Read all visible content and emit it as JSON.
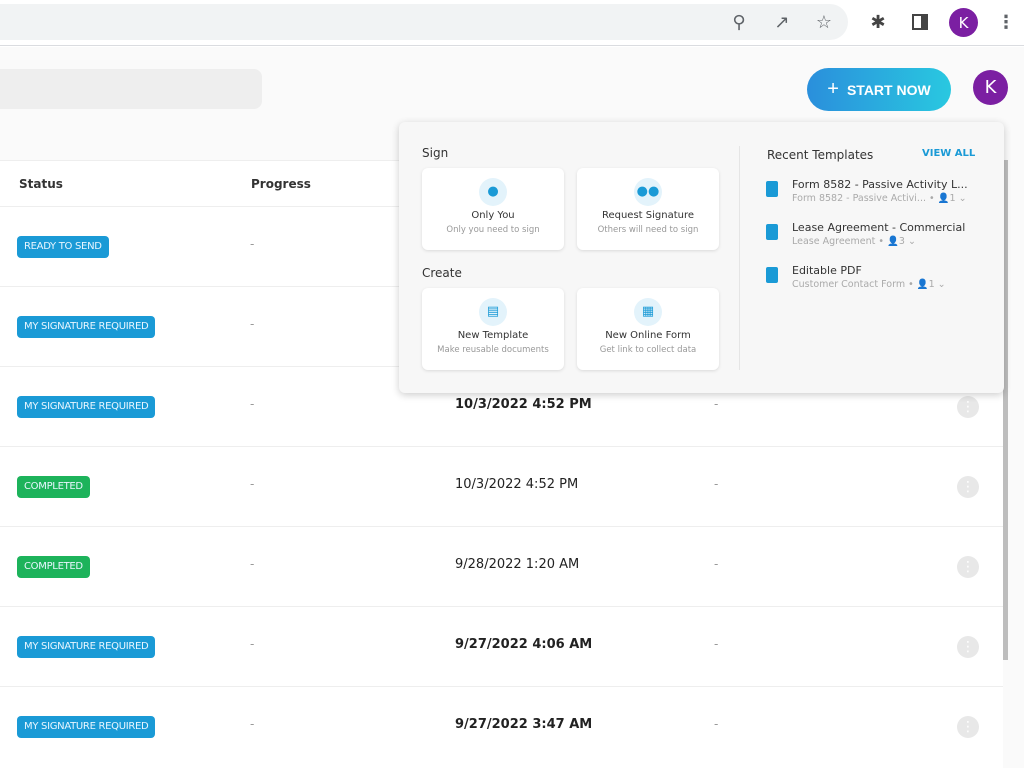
{
  "browser": {
    "avatar_letter": "K",
    "icons": [
      "zoom-out-icon",
      "share-icon",
      "bookmark-star-icon",
      "extensions-icon",
      "side-panel-icon",
      "menu-icon"
    ]
  },
  "header": {
    "start_button": "START NOW",
    "avatar_letter": "K",
    "accent": "#2a8fdc"
  },
  "table": {
    "columns": [
      "Status",
      "Progress"
    ],
    "rows": [
      {
        "status": "READY TO SEND",
        "color": "#1a9ad6",
        "progress": "-",
        "date": "",
        "extra": "",
        "bold": false
      },
      {
        "status": "MY SIGNATURE REQUIRED",
        "color": "#1a9ad6",
        "progress": "-",
        "date": "",
        "extra": "",
        "bold": false
      },
      {
        "status": "MY SIGNATURE REQUIRED",
        "color": "#1a9ad6",
        "progress": "-",
        "date": "10/3/2022 4:52 PM",
        "extra": "-",
        "bold": true
      },
      {
        "status": "COMPLETED",
        "color": "#1db35b",
        "progress": "-",
        "date": "10/3/2022 4:52 PM",
        "extra": "-",
        "bold": false
      },
      {
        "status": "COMPLETED",
        "color": "#1db35b",
        "progress": "-",
        "date": "9/28/2022 1:20 AM",
        "extra": "-",
        "bold": false
      },
      {
        "status": "MY SIGNATURE REQUIRED",
        "color": "#1a9ad6",
        "progress": "-",
        "date": "9/27/2022 4:06 AM",
        "extra": "-",
        "bold": true
      },
      {
        "status": "MY SIGNATURE REQUIRED",
        "color": "#1a9ad6",
        "progress": "-",
        "date": "9/27/2022 3:47 AM",
        "extra": "-",
        "bold": true
      }
    ]
  },
  "popup": {
    "sign_label": "Sign",
    "create_label": "Create",
    "sign_cards": [
      {
        "title": "Only You",
        "subtitle": "Only you need to sign"
      },
      {
        "title": "Request Signature",
        "subtitle": "Others will need to sign"
      }
    ],
    "create_cards": [
      {
        "title": "New Template",
        "subtitle": "Make reusable documents"
      },
      {
        "title": "New Online Form",
        "subtitle": "Get link to collect data"
      }
    ],
    "recent_label": "Recent Templates",
    "view_all": "VIEW ALL",
    "templates": [
      {
        "name": "Form 8582 - Passive Activity L...",
        "sub": "Form 8582 - Passive Activi...",
        "signers": "1"
      },
      {
        "name": "Lease Agreement - Commercial",
        "sub": "Lease Agreement",
        "signers": "3"
      },
      {
        "name": "Editable PDF",
        "sub": "Customer Contact Form",
        "signers": "1"
      }
    ]
  }
}
